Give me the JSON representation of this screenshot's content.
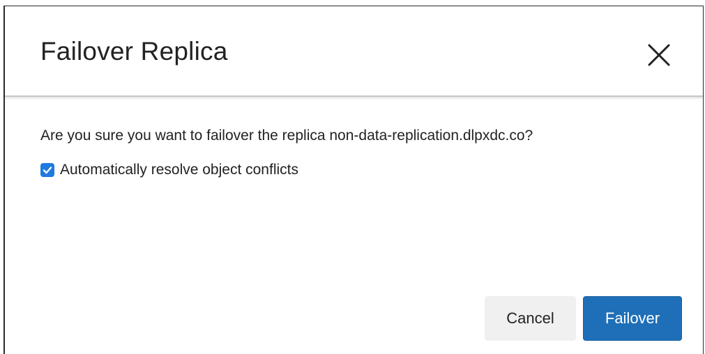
{
  "dialog": {
    "title": "Failover Replica",
    "close_icon": "close-icon",
    "message": "Are you sure you want to failover the replica non-data-replication.dlpxdc.co?",
    "checkbox": {
      "label": "Automatically resolve object conflicts",
      "checked": true
    },
    "buttons": {
      "cancel_label": "Cancel",
      "confirm_label": "Failover"
    }
  },
  "colors": {
    "primary": "#1e6fb8",
    "checkbox": "#1f7ae0",
    "cancel_bg": "#f0f0f0",
    "text": "#222222"
  }
}
